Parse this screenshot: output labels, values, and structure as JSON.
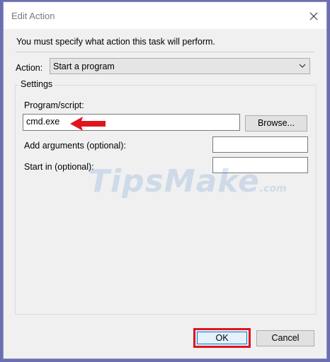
{
  "window": {
    "title": "Edit Action"
  },
  "instruction": "You must specify what action this task will perform.",
  "action": {
    "label": "Action:",
    "selected": "Start a program"
  },
  "settings": {
    "group_label": "Settings",
    "program_label": "Program/script:",
    "program_value": "cmd.exe",
    "browse_label": "Browse...",
    "args_label": "Add arguments (optional):",
    "args_value": "",
    "start_in_label": "Start in (optional):",
    "start_in_value": ""
  },
  "watermark": {
    "main": "TipsMake",
    "domain": ".com"
  },
  "buttons": {
    "ok": "OK",
    "cancel": "Cancel"
  },
  "colors": {
    "highlight_red": "#e0141e",
    "arrow_red": "#e0141e",
    "background_purple": "#6a6fb4"
  },
  "icons": {
    "close": "close-icon",
    "dropdown": "chevron-down-icon",
    "annotation": "red-arrow-icon"
  }
}
